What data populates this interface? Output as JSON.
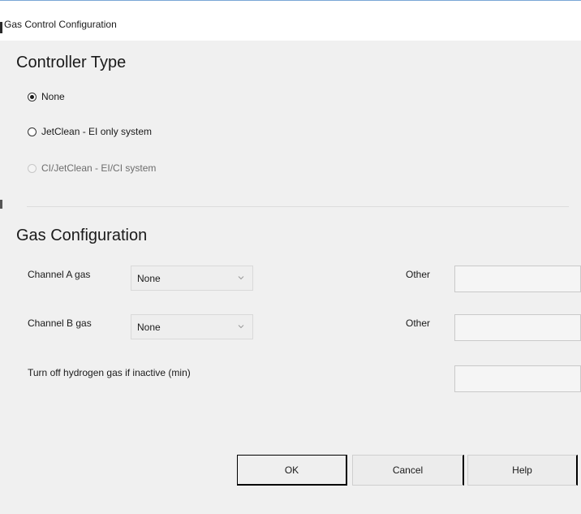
{
  "window": {
    "title": "Gas Control Configuration"
  },
  "controller_type": {
    "heading": "Controller Type",
    "options": [
      {
        "label": "None",
        "checked": true,
        "enabled": true
      },
      {
        "label": "JetClean - EI only system",
        "checked": false,
        "enabled": true
      },
      {
        "label": "CI/JetClean - EI/CI system",
        "checked": false,
        "enabled": false
      }
    ]
  },
  "gas_configuration": {
    "heading": "Gas Configuration",
    "channel_a": {
      "label": "Channel A gas",
      "value": "None",
      "other_label": "Other",
      "other_value": ""
    },
    "channel_b": {
      "label": "Channel B gas",
      "value": "None",
      "other_label": "Other",
      "other_value": ""
    },
    "hydrogen": {
      "label": "Turn off hydrogen gas if inactive (min)",
      "value": ""
    }
  },
  "buttons": {
    "ok": "OK",
    "cancel": "Cancel",
    "help": "Help"
  }
}
